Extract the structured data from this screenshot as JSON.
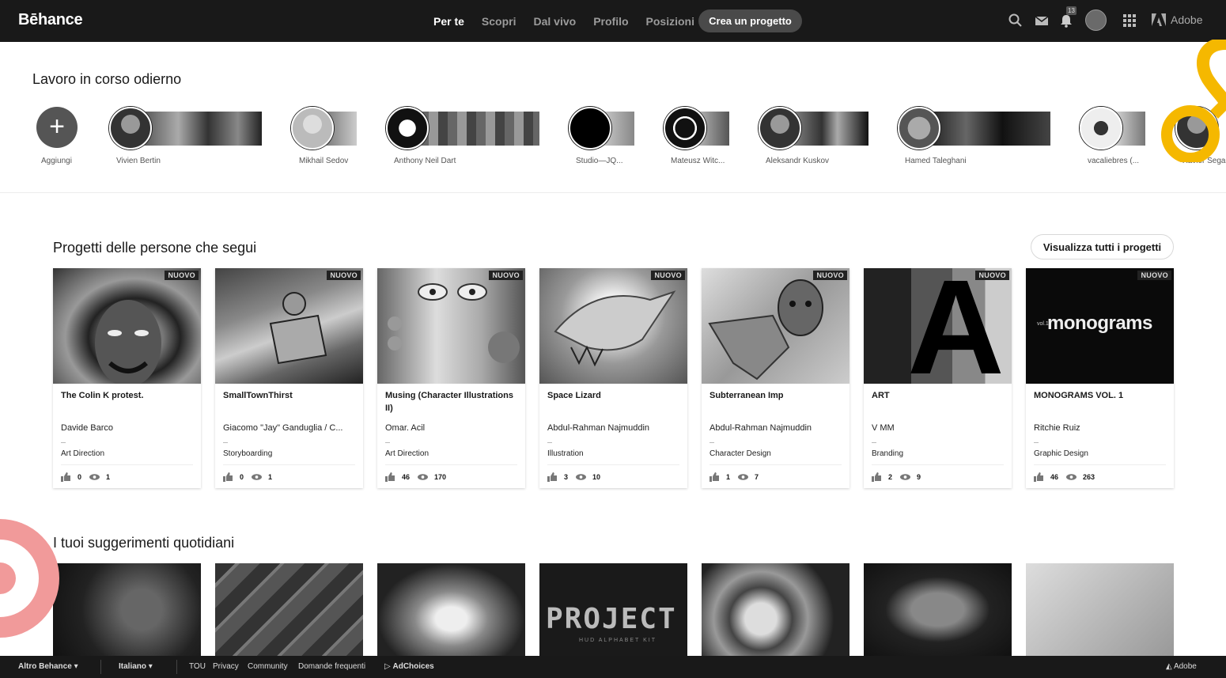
{
  "header": {
    "logo": "Bēhance",
    "nav": [
      "Per te",
      "Scopri",
      "Dal vivo",
      "Profilo",
      "Posizioni"
    ],
    "create_label": "Crea un progetto",
    "notif_count": "13",
    "adobe_label": "Adobe"
  },
  "wip": {
    "title": "Lavoro in corso odierno",
    "add_label": "Aggiungi",
    "people": [
      {
        "name": "Vivien Bertin"
      },
      {
        "name": "Mikhail Sedov"
      },
      {
        "name": "Anthony Neil Dart"
      },
      {
        "name": "Studio—JQ..."
      },
      {
        "name": "Mateusz Witc..."
      },
      {
        "name": "Aleksandr Kuskov"
      },
      {
        "name": "Hamed Taleghani"
      },
      {
        "name": "vacaliebres (..."
      },
      {
        "name": "Xavier Segar"
      }
    ]
  },
  "projects": {
    "title": "Progetti delle persone che segui",
    "view_all": "Visualizza tutti i progetti",
    "badge": "NUOVO",
    "items": [
      {
        "title": "The Colin K protest.",
        "author": "Davide Barco",
        "category": "Art Direction",
        "likes": "0",
        "views": "1"
      },
      {
        "title": "SmallTownThirst",
        "author": "Giacomo \"Jay\" Ganduglia / C...",
        "category": "Storyboarding",
        "likes": "0",
        "views": "1"
      },
      {
        "title": "Musing (Character Illustrations II)",
        "author": "Omar. Acil",
        "category": "Art Direction",
        "likes": "46",
        "views": "170"
      },
      {
        "title": "Space Lizard",
        "author": "Abdul-Rahman Najmuddin",
        "category": "Illustration",
        "likes": "3",
        "views": "10"
      },
      {
        "title": "Subterranean Imp",
        "author": "Abdul-Rahman Najmuddin",
        "category": "Character Design",
        "likes": "1",
        "views": "7"
      },
      {
        "title": "ART",
        "author": "V MM",
        "category": "Branding",
        "likes": "2",
        "views": "9"
      },
      {
        "title": "MONOGRAMS VOL. 1",
        "author": "Ritchie Ruiz",
        "category": "Graphic Design",
        "likes": "46",
        "views": "263"
      }
    ],
    "monograms_text": "monograms",
    "monograms_vol": "vol.1",
    "art_letter": "A"
  },
  "suggestions": {
    "title": "I tuoi suggerimenti quotidiani",
    "project_text": "PROJECT",
    "project_sub": "HUD ALPHABET KIT"
  },
  "footer": {
    "more": "Altro Behance",
    "language": "Italiano",
    "links": [
      "TOU",
      "Privacy",
      "Community",
      "Domande frequenti"
    ],
    "adchoices": "AdChoices",
    "adobe": "Adobe"
  }
}
